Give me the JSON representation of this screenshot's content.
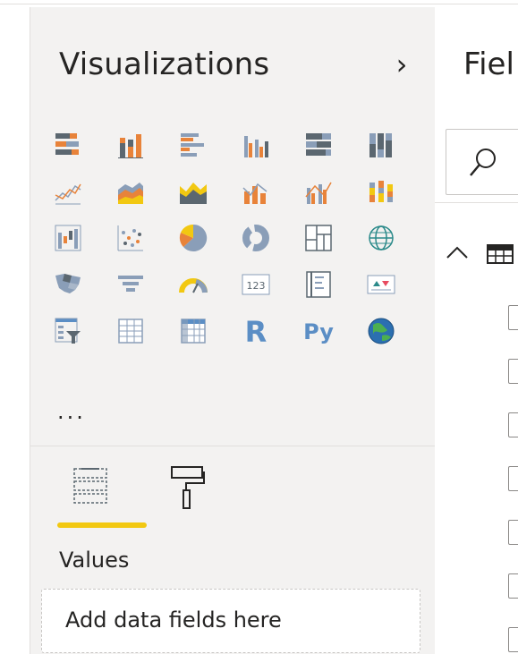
{
  "visualizations_pane": {
    "title": "Visualizations",
    "collapse_icon": "chevron-right-icon",
    "icons": [
      "stacked-bar-chart-icon",
      "stacked-column-chart-icon",
      "clustered-bar-chart-icon",
      "clustered-column-chart-icon",
      "100-percent-stacked-bar-chart-icon",
      "100-percent-stacked-column-chart-icon",
      "line-chart-icon",
      "area-chart-icon",
      "stacked-area-chart-icon",
      "line-and-stacked-column-chart-icon",
      "line-and-clustered-column-chart-icon",
      "ribbon-chart-icon",
      "waterfall-chart-icon",
      "scatter-chart-icon",
      "pie-chart-icon",
      "donut-chart-icon",
      "treemap-icon",
      "map-icon",
      "filled-map-icon",
      "funnel-icon",
      "gauge-icon",
      "card-icon",
      "multi-row-card-icon",
      "kpi-icon",
      "slicer-icon",
      "table-icon",
      "matrix-icon",
      "r-script-visual-icon",
      "python-visual-icon",
      "arcgis-map-icon"
    ],
    "card_text": "123",
    "r_label": "R",
    "py_label": "Py",
    "more_label": "...",
    "tabs": [
      {
        "name": "fields-tab",
        "icon": "fields-icon",
        "active": true
      },
      {
        "name": "format-tab",
        "icon": "paint-roller-icon",
        "active": false
      }
    ],
    "values_label": "Values",
    "drop_zone_placeholder": "Add data fields here"
  },
  "fields_pane": {
    "title": "Fiel",
    "search_icon": "search-icon",
    "table_expand_icon": "chevron-up-icon",
    "table_icon": "table-icon",
    "checkbox_count": 7
  },
  "colors": {
    "orange": "#e8833a",
    "blue_gray": "#8a9eb8",
    "dark_gray": "#5b6770",
    "yellow": "#f2c811",
    "pane_bg": "#f3f2f1",
    "text": "#252423"
  }
}
